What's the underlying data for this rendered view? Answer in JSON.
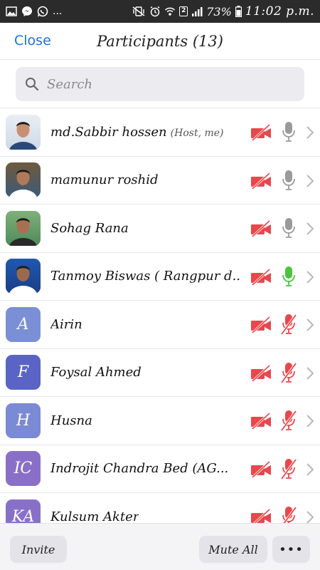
{
  "status_bar": {
    "notification_icons": [
      "gallery-icon",
      "messenger-icon",
      "whatsapp-icon"
    ],
    "more_indicator": "...",
    "system_icons": [
      "vibrate-off-icon",
      "alarm-icon",
      "wifi-icon",
      "sim-icon",
      "signal-icon"
    ],
    "sim_number": "2",
    "battery": "73%",
    "time": "11:02 p.m."
  },
  "header": {
    "close_label": "Close",
    "title": "Participants (13)"
  },
  "search": {
    "placeholder": "Search",
    "value": ""
  },
  "colors": {
    "accent": "#1f6fd6",
    "muted_red": "#e8474c",
    "mic_grey": "#9a9a9a",
    "mic_active_green": "#4cc33f"
  },
  "participants": [
    {
      "name": "md.Sabbir hossen",
      "suffix": "(Host, me)",
      "avatar": {
        "type": "photo"
      },
      "video": "off",
      "mic": "unmuted"
    },
    {
      "name": "mamunur roshid",
      "suffix": "",
      "avatar": {
        "type": "photo"
      },
      "video": "off",
      "mic": "unmuted"
    },
    {
      "name": "Sohag Rana",
      "suffix": "",
      "avatar": {
        "type": "photo"
      },
      "video": "off",
      "mic": "unmuted"
    },
    {
      "name": "Tanmoy Biswas ( Rangpur d...",
      "suffix": "",
      "avatar": {
        "type": "photo"
      },
      "video": "off",
      "mic": "speaking"
    },
    {
      "name": "Airin",
      "suffix": "",
      "avatar": {
        "type": "initials",
        "initials": "A",
        "color": "#7a8fd6"
      },
      "video": "off",
      "mic": "muted"
    },
    {
      "name": "Foysal Ahmed",
      "suffix": "",
      "avatar": {
        "type": "initials",
        "initials": "F",
        "color": "#5a64c4"
      },
      "video": "off",
      "mic": "muted"
    },
    {
      "name": "Husna",
      "suffix": "",
      "avatar": {
        "type": "initials",
        "initials": "H",
        "color": "#7b8ad4"
      },
      "video": "off",
      "mic": "muted"
    },
    {
      "name": "Indrojit Chandra Bed (AG...",
      "suffix": "",
      "avatar": {
        "type": "initials",
        "initials": "IC",
        "color": "#8a6fc9"
      },
      "video": "off",
      "mic": "muted"
    },
    {
      "name": "Kulsum Akter",
      "suffix": "",
      "avatar": {
        "type": "initials",
        "initials": "KA",
        "color": "#8870c8"
      },
      "video": "off",
      "mic": "muted"
    }
  ],
  "footer": {
    "invite_label": "Invite",
    "mute_all_label": "Mute All",
    "more_label": "•••"
  }
}
